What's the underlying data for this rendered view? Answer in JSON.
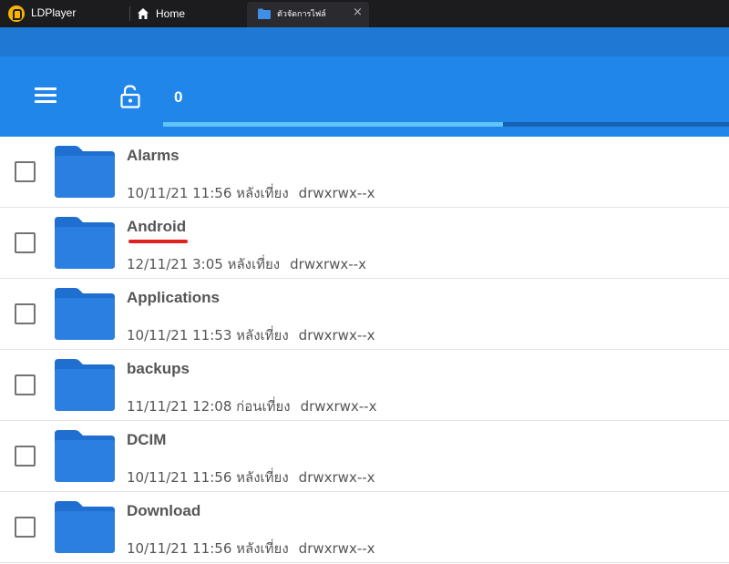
{
  "window": {
    "app_name": "LDPlayer",
    "home_tab_label": "Home",
    "active_tab_label": "ตัวจัดการไฟล์",
    "close_glyph": "×"
  },
  "appbar": {
    "count": "0",
    "progress": 0.6
  },
  "colors": {
    "appbar": "#2186ea",
    "status_strip": "#1f79d4",
    "folder": "#1e6fd0",
    "highlight": "#e0211f"
  },
  "files": [
    {
      "name": "Alarms",
      "date": "10/11/21 11:56 หลังเที่ยง",
      "permissions": "drwxrwx--x",
      "highlighted": false
    },
    {
      "name": "Android",
      "date": "12/11/21 3:05 หลังเที่ยง",
      "permissions": "drwxrwx--x",
      "highlighted": true
    },
    {
      "name": "Applications",
      "date": "10/11/21 11:53 หลังเที่ยง",
      "permissions": "drwxrwx--x",
      "highlighted": false
    },
    {
      "name": "backups",
      "date": "11/11/21 12:08 ก่อนเที่ยง",
      "permissions": "drwxrwx--x",
      "highlighted": false
    },
    {
      "name": "DCIM",
      "date": "10/11/21 11:56 หลังเที่ยง",
      "permissions": "drwxrwx--x",
      "highlighted": false
    },
    {
      "name": "Download",
      "date": "10/11/21 11:56 หลังเที่ยง",
      "permissions": "drwxrwx--x",
      "highlighted": false
    }
  ]
}
